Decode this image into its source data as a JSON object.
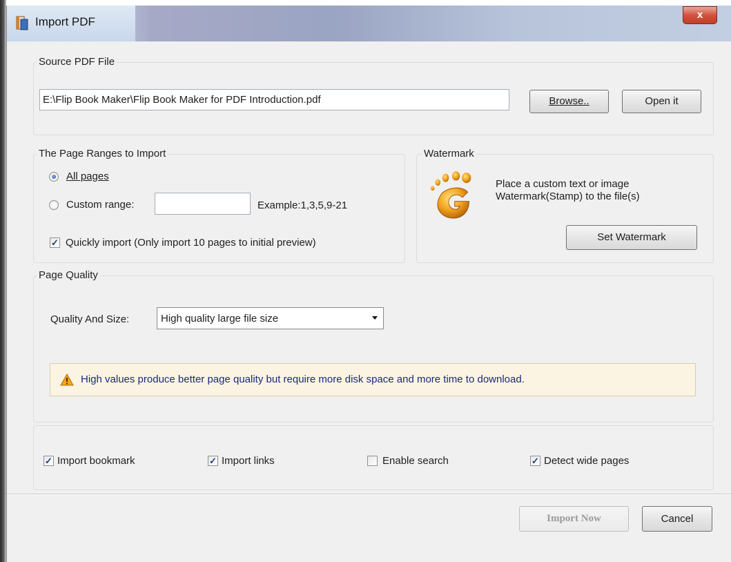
{
  "window": {
    "title": "Import PDF",
    "close_label": "x"
  },
  "source": {
    "group_label": "Source PDF File",
    "file_path": "E:\\Flip Book Maker\\Flip Book Maker for PDF Introduction.pdf",
    "browse_label": "Browse..",
    "open_label": "Open it"
  },
  "ranges": {
    "group_label": "The Page Ranges to Import",
    "all_pages_label": "All pages",
    "all_pages_selected": true,
    "custom_range_label": "Custom range:",
    "custom_range_value": "",
    "example_text": "Example:1,3,5,9-21",
    "quick_import_label": "Quickly import (Only import 10 pages to  initial  preview)",
    "quick_import_checked": true
  },
  "watermark": {
    "group_label": "Watermark",
    "description_line1": "Place a custom text or image",
    "description_line2": "Watermark(Stamp) to the file(s)",
    "button_label": "Set Watermark",
    "icon": "footprint-icon"
  },
  "quality": {
    "group_label": "Page Quality",
    "field_label": "Quality And Size:",
    "selected_option": "High quality large file size",
    "notice_text": "High values produce better page quality but require more disk space and more time to download.",
    "notice_icon": "warning-icon"
  },
  "options": {
    "import_bookmark_label": "Import bookmark",
    "import_bookmark_checked": true,
    "import_links_label": "Import links",
    "import_links_checked": true,
    "enable_search_label": "Enable search",
    "enable_search_checked": false,
    "detect_wide_label": "Detect wide pages",
    "detect_wide_checked": true
  },
  "footer": {
    "import_now_label": "Import Now",
    "cancel_label": "Cancel"
  },
  "colors": {
    "accent": "#23569f",
    "notice_bg": "#fbf4e2",
    "notice_text": "#1a2a7a",
    "close_button": "#d3533e"
  }
}
